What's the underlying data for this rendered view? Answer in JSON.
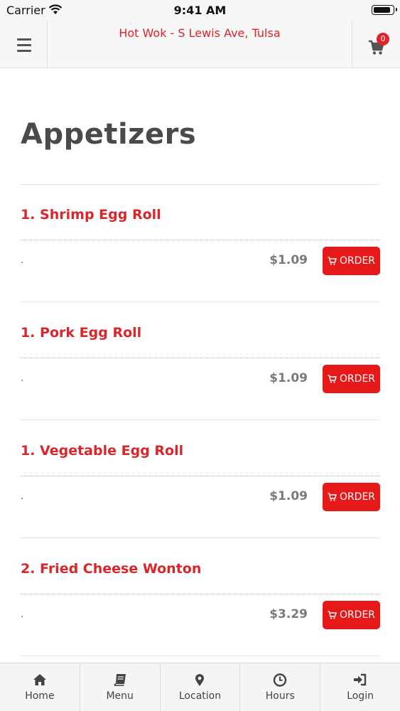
{
  "status_bar": {
    "carrier": "Carrier",
    "time": "9:41 AM",
    "battery_level": 0.95
  },
  "header": {
    "title": "Hot Wok - S Lewis Ave, Tulsa",
    "cart_count": "0"
  },
  "section": {
    "title": "Appetizers"
  },
  "items": [
    {
      "name": "1. Shrimp Egg Roll",
      "description": ".",
      "price": "$1.09",
      "order_label": "ORDER"
    },
    {
      "name": "1. Pork Egg Roll",
      "description": ".",
      "price": "$1.09",
      "order_label": "ORDER"
    },
    {
      "name": "1. Vegetable Egg Roll",
      "description": ".",
      "price": "$1.09",
      "order_label": "ORDER"
    },
    {
      "name": "2. Fried Cheese Wonton",
      "description": ".",
      "price": "$3.29",
      "order_label": "ORDER"
    }
  ],
  "tabs": [
    {
      "label": "Home",
      "icon": "home-icon"
    },
    {
      "label": "Menu",
      "icon": "book-icon"
    },
    {
      "label": "Location",
      "icon": "map-pin-icon"
    },
    {
      "label": "Hours",
      "icon": "clock-icon"
    },
    {
      "label": "Login",
      "icon": "login-icon"
    }
  ],
  "colors": {
    "accent": "#e0232a",
    "order_button": "#e71818",
    "text": "#4a4a4a"
  }
}
